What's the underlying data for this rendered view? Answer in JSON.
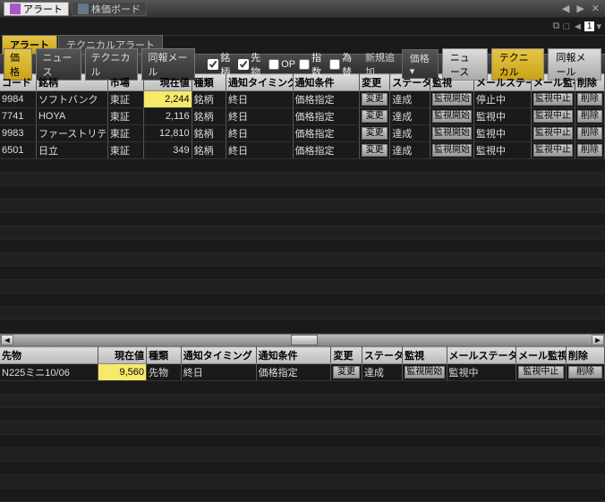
{
  "title_tabs": [
    "アラート",
    "株価ボード"
  ],
  "pager": {
    "value": "1"
  },
  "sub_tabs": [
    "アラート",
    "テクニカルアラート"
  ],
  "toolbar": {
    "filter_buttons": [
      "価格",
      "ニュース",
      "テクニカル",
      "同報メール"
    ],
    "checks": [
      {
        "label": "銘柄",
        "checked": true
      },
      {
        "label": "先物",
        "checked": true
      },
      {
        "label": "OP",
        "checked": false
      },
      {
        "label": "指数",
        "checked": false
      },
      {
        "label": "為替",
        "checked": false
      }
    ],
    "new_add": "新規追加",
    "right_buttons": [
      "価格",
      "ニュース",
      "テクニカル",
      "同報メール"
    ]
  },
  "grid1": {
    "headers": [
      "コード",
      "銘柄",
      "市場",
      "現在値",
      "種類",
      "通知タイミング",
      "通知条件",
      "変更",
      "ステータス",
      "監視",
      "メールステータス",
      "メール監視",
      "削除"
    ],
    "rows": [
      {
        "code": "9984",
        "name": "ソフトバンク",
        "mkt": "東証",
        "price": "2,244",
        "kind": "銘柄",
        "timing": "終日",
        "cond": "価格指定",
        "change": "変更",
        "status": "達成",
        "mon": "監視開始",
        "mstat": "停止中",
        "mmon": "監視中止",
        "del": "削除",
        "hl": true
      },
      {
        "code": "7741",
        "name": "HOYA",
        "mkt": "東証",
        "price": "2,116",
        "kind": "銘柄",
        "timing": "終日",
        "cond": "価格指定",
        "change": "変更",
        "status": "達成",
        "mon": "監視開始",
        "mstat": "監視中",
        "mmon": "監視中止",
        "del": "削除"
      },
      {
        "code": "9983",
        "name": "ファーストリテ",
        "mkt": "東証",
        "price": "12,810",
        "kind": "銘柄",
        "timing": "終日",
        "cond": "価格指定",
        "change": "変更",
        "status": "達成",
        "mon": "監視開始",
        "mstat": "監視中",
        "mmon": "監視中止",
        "del": "削除"
      },
      {
        "code": "6501",
        "name": "日立",
        "mkt": "東証",
        "price": "349",
        "kind": "銘柄",
        "timing": "終日",
        "cond": "価格指定",
        "change": "変更",
        "status": "達成",
        "mon": "監視開始",
        "mstat": "監視中",
        "mmon": "監視中止",
        "del": "削除"
      }
    ]
  },
  "grid2": {
    "headers": [
      "先物",
      "現在値",
      "種類",
      "通知タイミング",
      "通知条件",
      "変更",
      "ステータス",
      "監視",
      "メールステータス",
      "メール監視",
      "削除"
    ],
    "rows": [
      {
        "name": "N225ミニ10/06",
        "price": "9,560",
        "kind": "先物",
        "timing": "終日",
        "cond": "価格指定",
        "change": "変更",
        "status": "達成",
        "mon": "監視開始",
        "mstat": "監視中",
        "mmon": "監視中止",
        "del": "削除",
        "hl": true
      }
    ]
  }
}
